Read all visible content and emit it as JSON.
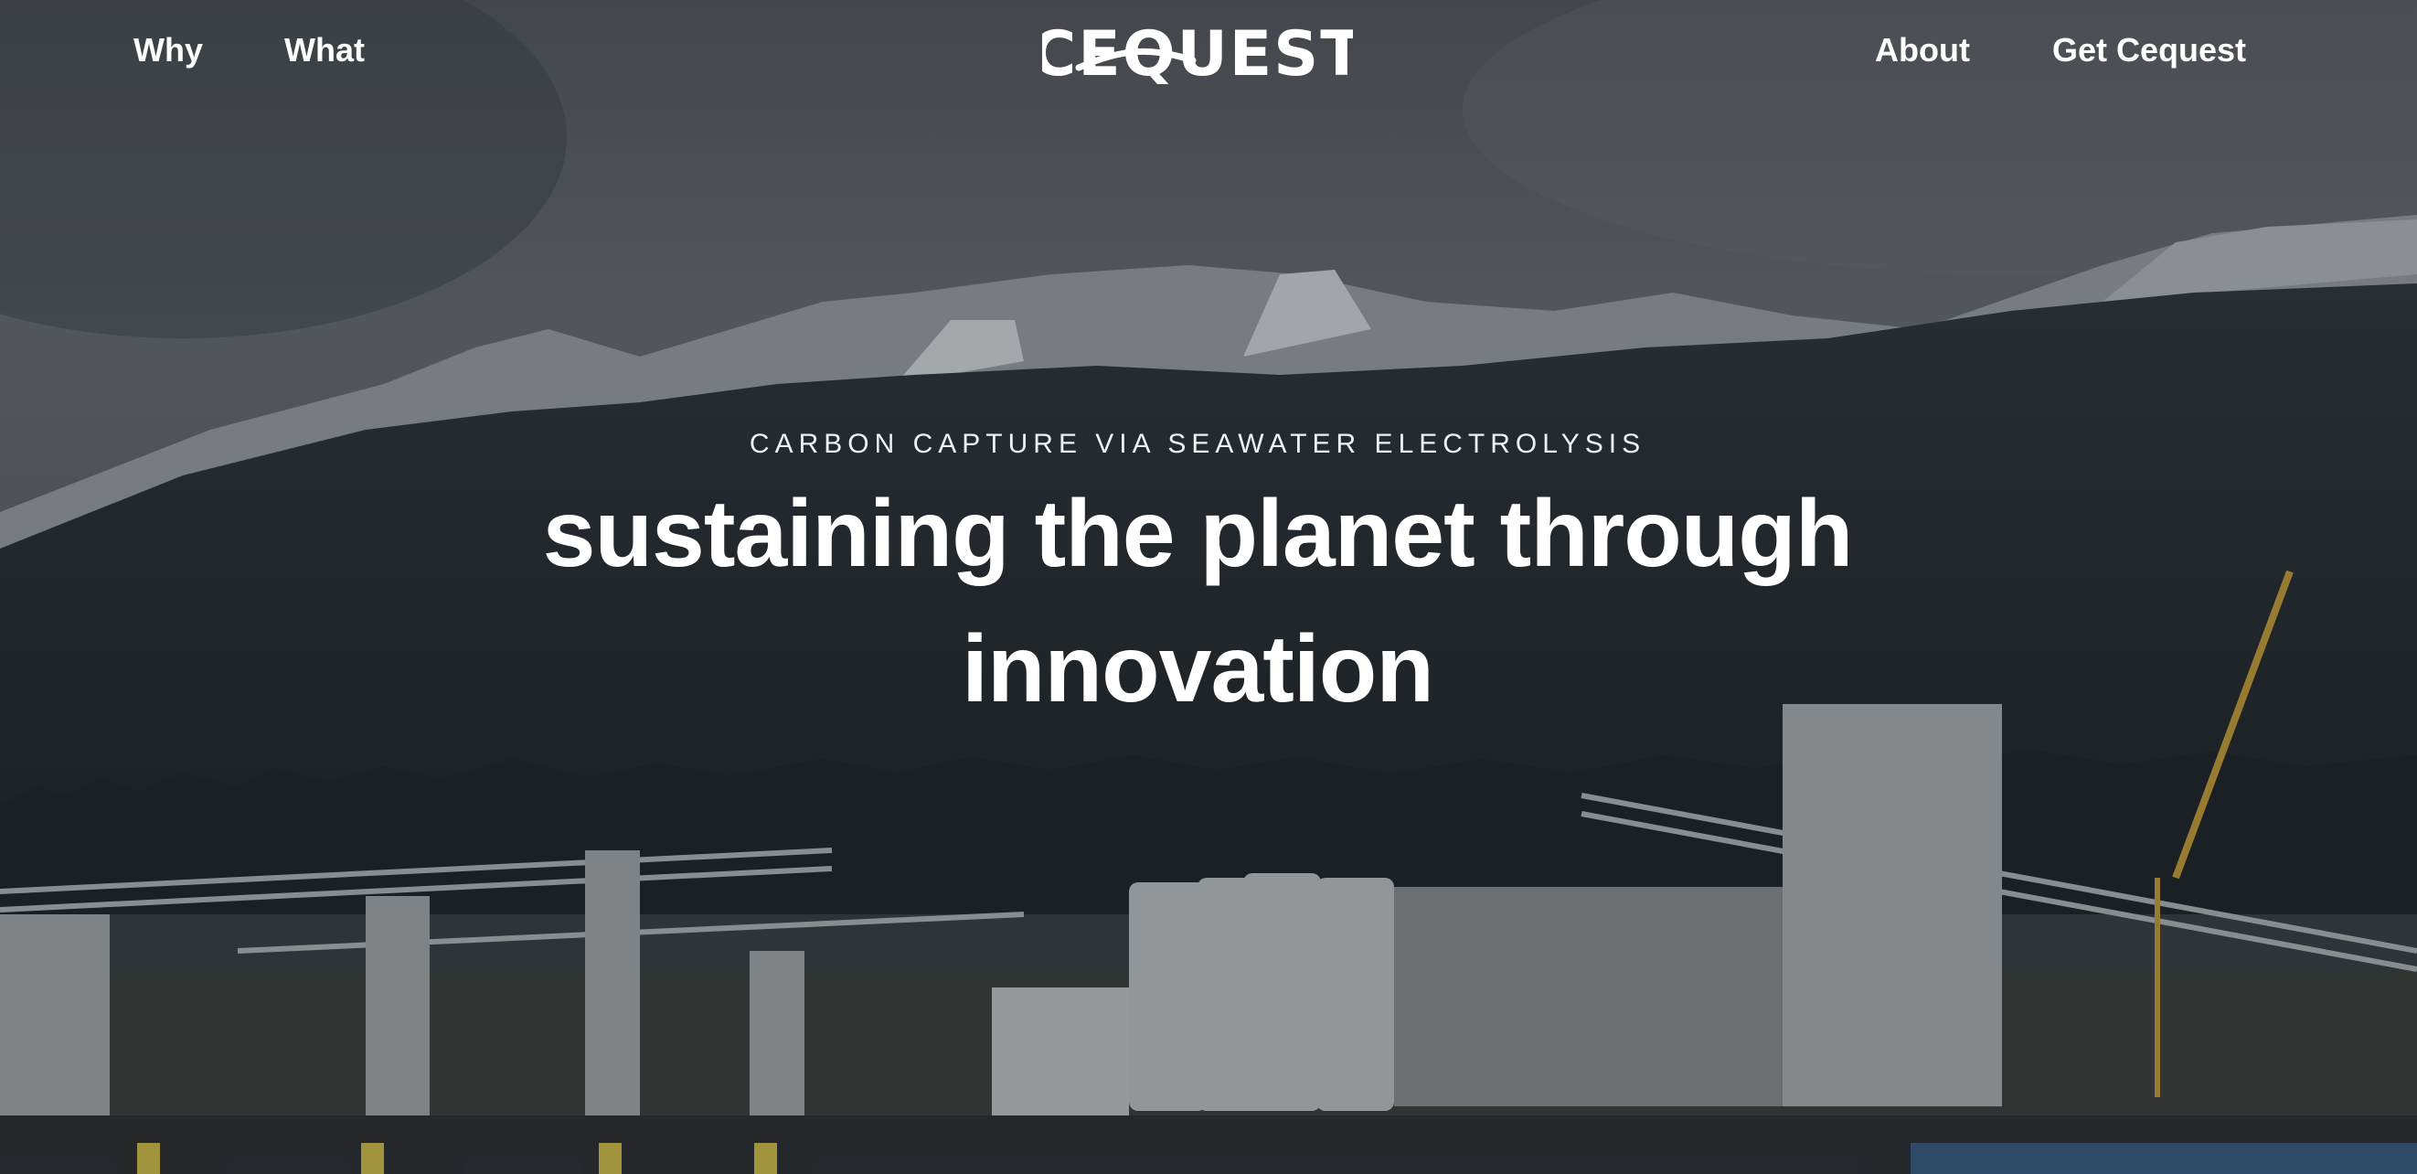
{
  "nav": {
    "left_links": [
      "Why",
      "What"
    ],
    "right_links": [
      "About",
      "Get Cequest"
    ],
    "logo_text": "CEQUEST"
  },
  "hero": {
    "eyebrow": "CARBON CAPTURE VIA SEAWATER ELECTROLYSIS",
    "headline": "sustaining the planet through innovation",
    "background_icon": "industrial-port-mountains-photo"
  },
  "colors": {
    "text": "#ffffff",
    "overlay": "#14181e",
    "sky": "#5c6068",
    "mountain": "#283038"
  }
}
